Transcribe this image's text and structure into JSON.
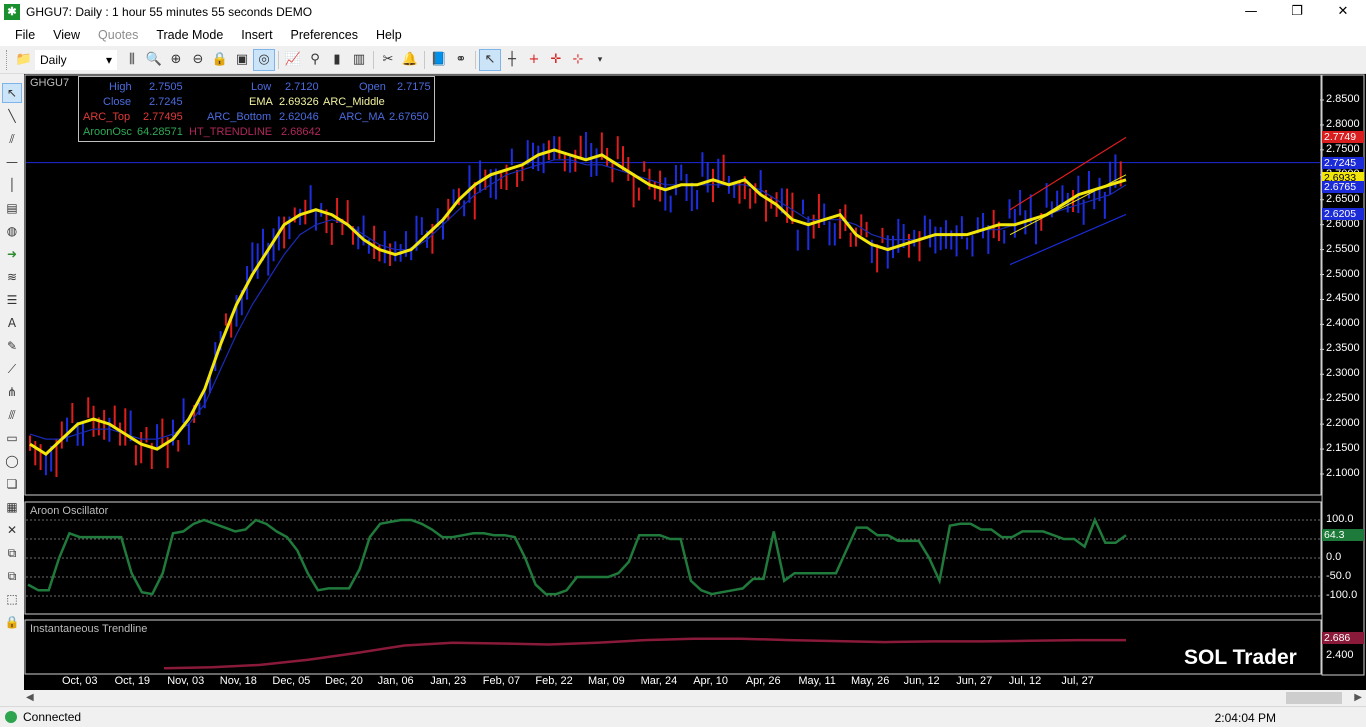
{
  "window": {
    "title": "GHGU7: Daily : 1 hour 55 minutes 55 seconds DEMO",
    "app_icon": "sol-trader-icon"
  },
  "menu": [
    {
      "label": "File",
      "disabled": false
    },
    {
      "label": "View",
      "disabled": false
    },
    {
      "label": "Quotes",
      "disabled": true
    },
    {
      "label": "Trade Mode",
      "disabled": false
    },
    {
      "label": "Insert",
      "disabled": false
    },
    {
      "label": "Preferences",
      "disabled": false
    },
    {
      "label": "Help",
      "disabled": false
    }
  ],
  "toolbar": {
    "period": "Daily"
  },
  "chart": {
    "symbol": "GHGU7",
    "info": {
      "high_label": "High",
      "high": "2.7505",
      "low_label": "Low",
      "low": "2.7120",
      "open_label": "Open",
      "open": "2.7175",
      "close_label": "Close",
      "close": "2.7245",
      "ema_label": "EMA",
      "ema": "2.69326",
      "arc_middle_label": "ARC_Middle",
      "arc_top_label": "ARC_Top",
      "arc_top": "2.77495",
      "arc_bottom_label": "ARC_Bottom",
      "arc_bottom": "2.62046",
      "arc_ma_label": "ARC_MA",
      "arc_ma": "2.67650",
      "aroon_label": "AroonOsc",
      "aroon": "64.28571",
      "ht_label": "HT_TRENDLINE",
      "ht": "2.68642"
    },
    "price_axis": [
      "2.8500",
      "2.8000",
      "2.7500",
      "2.7000",
      "2.6500",
      "2.6000",
      "2.5500",
      "2.5000",
      "2.4500",
      "2.4000",
      "2.3500",
      "2.3000",
      "2.2500",
      "2.2000",
      "2.1500",
      "2.1000"
    ],
    "price_tags": [
      {
        "text": "2.7749",
        "bg": "#d81e1e"
      },
      {
        "text": "2.7245",
        "bg": "#1c2bd8"
      },
      {
        "text": "2.6933",
        "bg": "#f2e60a"
      },
      {
        "text": "2.6765",
        "bg": "#1c2bd8"
      },
      {
        "text": "2.6205",
        "bg": "#1c2bd8"
      }
    ],
    "aroon_panel": {
      "title": "Aroon Oscillator",
      "axis": [
        "100.0",
        "50.0",
        "0.0",
        "-50.0",
        "-100.0"
      ],
      "tag": "64.3",
      "values": [
        -70,
        -85,
        -85,
        0,
        65,
        55,
        55,
        55,
        55,
        55,
        -40,
        -90,
        -95,
        -40,
        65,
        70,
        90,
        100,
        90,
        80,
        70,
        75,
        100,
        90,
        70,
        55,
        20,
        -40,
        -85,
        -80,
        -80,
        -80,
        -30,
        55,
        90,
        95,
        100,
        100,
        90,
        75,
        55,
        55,
        60,
        65,
        65,
        60,
        60,
        55,
        0,
        -70,
        -95,
        -95,
        -85,
        -50,
        -50,
        -50,
        -50,
        -40,
        -10,
        60,
        60,
        60,
        50,
        50,
        -60,
        -85,
        -95,
        -90,
        -85,
        -80,
        -55,
        -55,
        70,
        -60,
        -40,
        -40,
        -40,
        -40,
        -40,
        20,
        80,
        80,
        60,
        60,
        45,
        45,
        45,
        0,
        -60,
        85,
        90,
        90,
        75,
        75,
        55,
        55,
        70,
        70,
        70,
        60,
        50,
        50,
        30,
        100,
        40,
        40,
        60
      ]
    },
    "trend_panel": {
      "title": "Instantaneous Trendline",
      "axis": [
        "2.400"
      ],
      "tag": "2.686"
    },
    "x_axis": [
      "Oct, 03",
      "Oct, 19",
      "Nov, 03",
      "Nov, 18",
      "Dec, 05",
      "Dec, 20",
      "Jan, 06",
      "Jan, 23",
      "Feb, 07",
      "Feb, 22",
      "Mar, 09",
      "Mar, 24",
      "Apr, 10",
      "Apr, 26",
      "May, 11",
      "May, 26",
      "Jun, 12",
      "Jun, 27",
      "Jul, 12",
      "Jul, 27"
    ],
    "ema": [
      2.16,
      2.14,
      2.17,
      2.2,
      2.21,
      2.2,
      2.18,
      2.16,
      2.15,
      2.17,
      2.21,
      2.27,
      2.36,
      2.44,
      2.5,
      2.55,
      2.6,
      2.62,
      2.63,
      2.62,
      2.6,
      2.57,
      2.55,
      2.54,
      2.55,
      2.58,
      2.61,
      2.65,
      2.68,
      2.7,
      2.71,
      2.72,
      2.74,
      2.75,
      2.74,
      2.73,
      2.74,
      2.72,
      2.7,
      2.68,
      2.67,
      2.68,
      2.68,
      2.69,
      2.68,
      2.69,
      2.66,
      2.64,
      2.61,
      2.6,
      2.61,
      2.62,
      2.58,
      2.56,
      2.55,
      2.56,
      2.57,
      2.58,
      2.58,
      2.58,
      2.59,
      2.6,
      2.6,
      2.61,
      2.62,
      2.64,
      2.66,
      2.67,
      2.68,
      2.69
    ],
    "arc_ma": [
      2.18,
      2.17,
      2.17,
      2.18,
      2.19,
      2.19,
      2.18,
      2.17,
      2.17,
      2.18,
      2.2,
      2.24,
      2.31,
      2.38,
      2.44,
      2.49,
      2.54,
      2.58,
      2.6,
      2.61,
      2.6,
      2.58,
      2.56,
      2.55,
      2.55,
      2.57,
      2.6,
      2.63,
      2.66,
      2.68,
      2.7,
      2.71,
      2.72,
      2.73,
      2.73,
      2.72,
      2.72,
      2.71,
      2.7,
      2.69,
      2.68,
      2.68,
      2.68,
      2.68,
      2.68,
      2.68,
      2.67,
      2.65,
      2.63,
      2.61,
      2.61,
      2.61,
      2.6,
      2.58,
      2.57,
      2.57,
      2.57,
      2.58,
      2.58,
      2.58,
      2.59,
      2.59,
      2.6,
      2.61,
      2.62,
      2.63,
      2.64,
      2.65,
      2.66,
      2.68
    ],
    "trend_values": [
      0.05,
      0.08,
      0.15,
      0.3,
      0.5,
      0.72,
      0.8,
      0.78,
      0.75,
      0.8,
      0.88,
      0.92,
      0.92,
      0.88,
      0.85,
      0.82,
      0.84,
      0.84,
      0.86,
      0.88,
      0.88
    ]
  },
  "brand": "SOL Trader",
  "status": {
    "connection": "Connected",
    "time": "2:04:04 PM"
  }
}
